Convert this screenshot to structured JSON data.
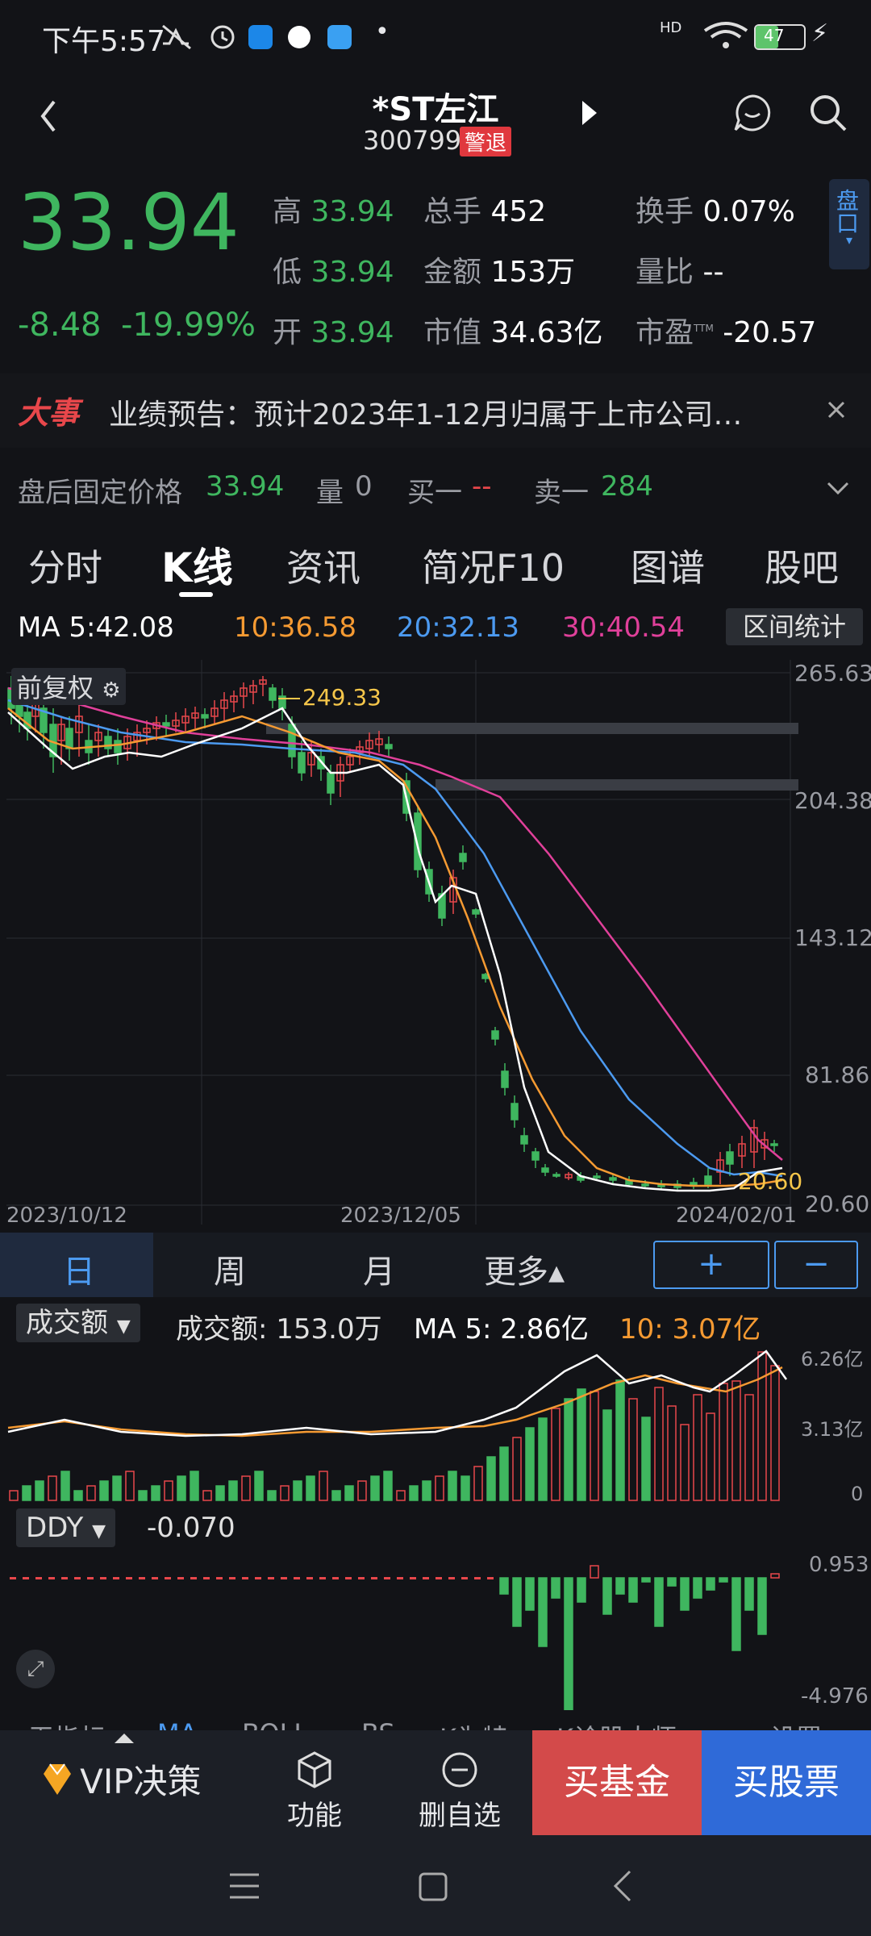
{
  "status": {
    "time": "下午5:57",
    "battery": "47",
    "network": "HD"
  },
  "header": {
    "title": "*ST左江",
    "code": "300799",
    "badge": "警退"
  },
  "quote": {
    "price": "33.94",
    "change": "-8.48",
    "change_pct": "-19.99%",
    "high_label": "高",
    "high": "33.94",
    "low_label": "低",
    "low": "33.94",
    "open_label": "开",
    "open": "33.94",
    "vol_label": "总手",
    "vol": "452",
    "amount_label": "金额",
    "amount": "153万",
    "mcap_label": "市值",
    "mcap": "34.63亿",
    "turnover_label": "换手",
    "turnover": "0.07%",
    "ratio_label": "量比",
    "ratio": "--",
    "pe_label": "市盈",
    "pe_sup": "TTM",
    "pe": "-20.57",
    "side_tab": "盘口"
  },
  "news": {
    "tag": "大事",
    "text": "业绩预告：预计2023年1-12月归属于上市公司…"
  },
  "afterhours": {
    "label": "盘后固定价格",
    "price": "33.94",
    "vol_label": "量",
    "vol": "0",
    "buy_label": "买一",
    "buy": "--",
    "sell_label": "卖一",
    "sell": "284"
  },
  "tabs": [
    "分时",
    "K线",
    "资讯",
    "简况F10",
    "图谱",
    "股吧"
  ],
  "ma": {
    "ma5": "MA 5:42.08",
    "ma10": "10:36.58",
    "ma20": "20:32.13",
    "ma30": "30:40.54",
    "range_btn": "区间统计"
  },
  "kchart": {
    "fq_label": "前复权",
    "y_ticks": [
      "265.63",
      "204.38",
      "143.12",
      "81.86",
      "20.60"
    ],
    "x_ticks": [
      "2023/10/12",
      "2023/12/05",
      "2024/02/01"
    ],
    "max_label": "249.33",
    "min_label": "20.60"
  },
  "periods": {
    "day": "日",
    "week": "周",
    "month": "月",
    "more": "更多▴",
    "plus": "+",
    "minus": "−"
  },
  "volume": {
    "selector": "成交额",
    "amount": "成交额: 153.0万",
    "ma5": "MA 5: 2.86亿",
    "ma10": "10: 3.07亿",
    "y_ticks": [
      "6.26亿",
      "3.13亿",
      "0"
    ]
  },
  "ddy": {
    "selector": "DDY",
    "value": "-0.070",
    "y_ticks": [
      "0.953",
      "-4.976"
    ]
  },
  "indicators": [
    "无指标",
    "MA",
    "BOLL",
    "BS",
    "K为特",
    "K诊股大师",
    "设置"
  ],
  "bottom": {
    "vip": "VIP决策",
    "func": "功能",
    "remove": "删自选",
    "buy_fund": "买基金",
    "buy_stock": "买股票"
  },
  "colors": {
    "up": "#e8474b",
    "down": "#3fb65f",
    "ma5": "#ffffff",
    "ma10": "#f59a32",
    "ma20": "#4c9af0",
    "ma30": "#e0409a"
  }
}
